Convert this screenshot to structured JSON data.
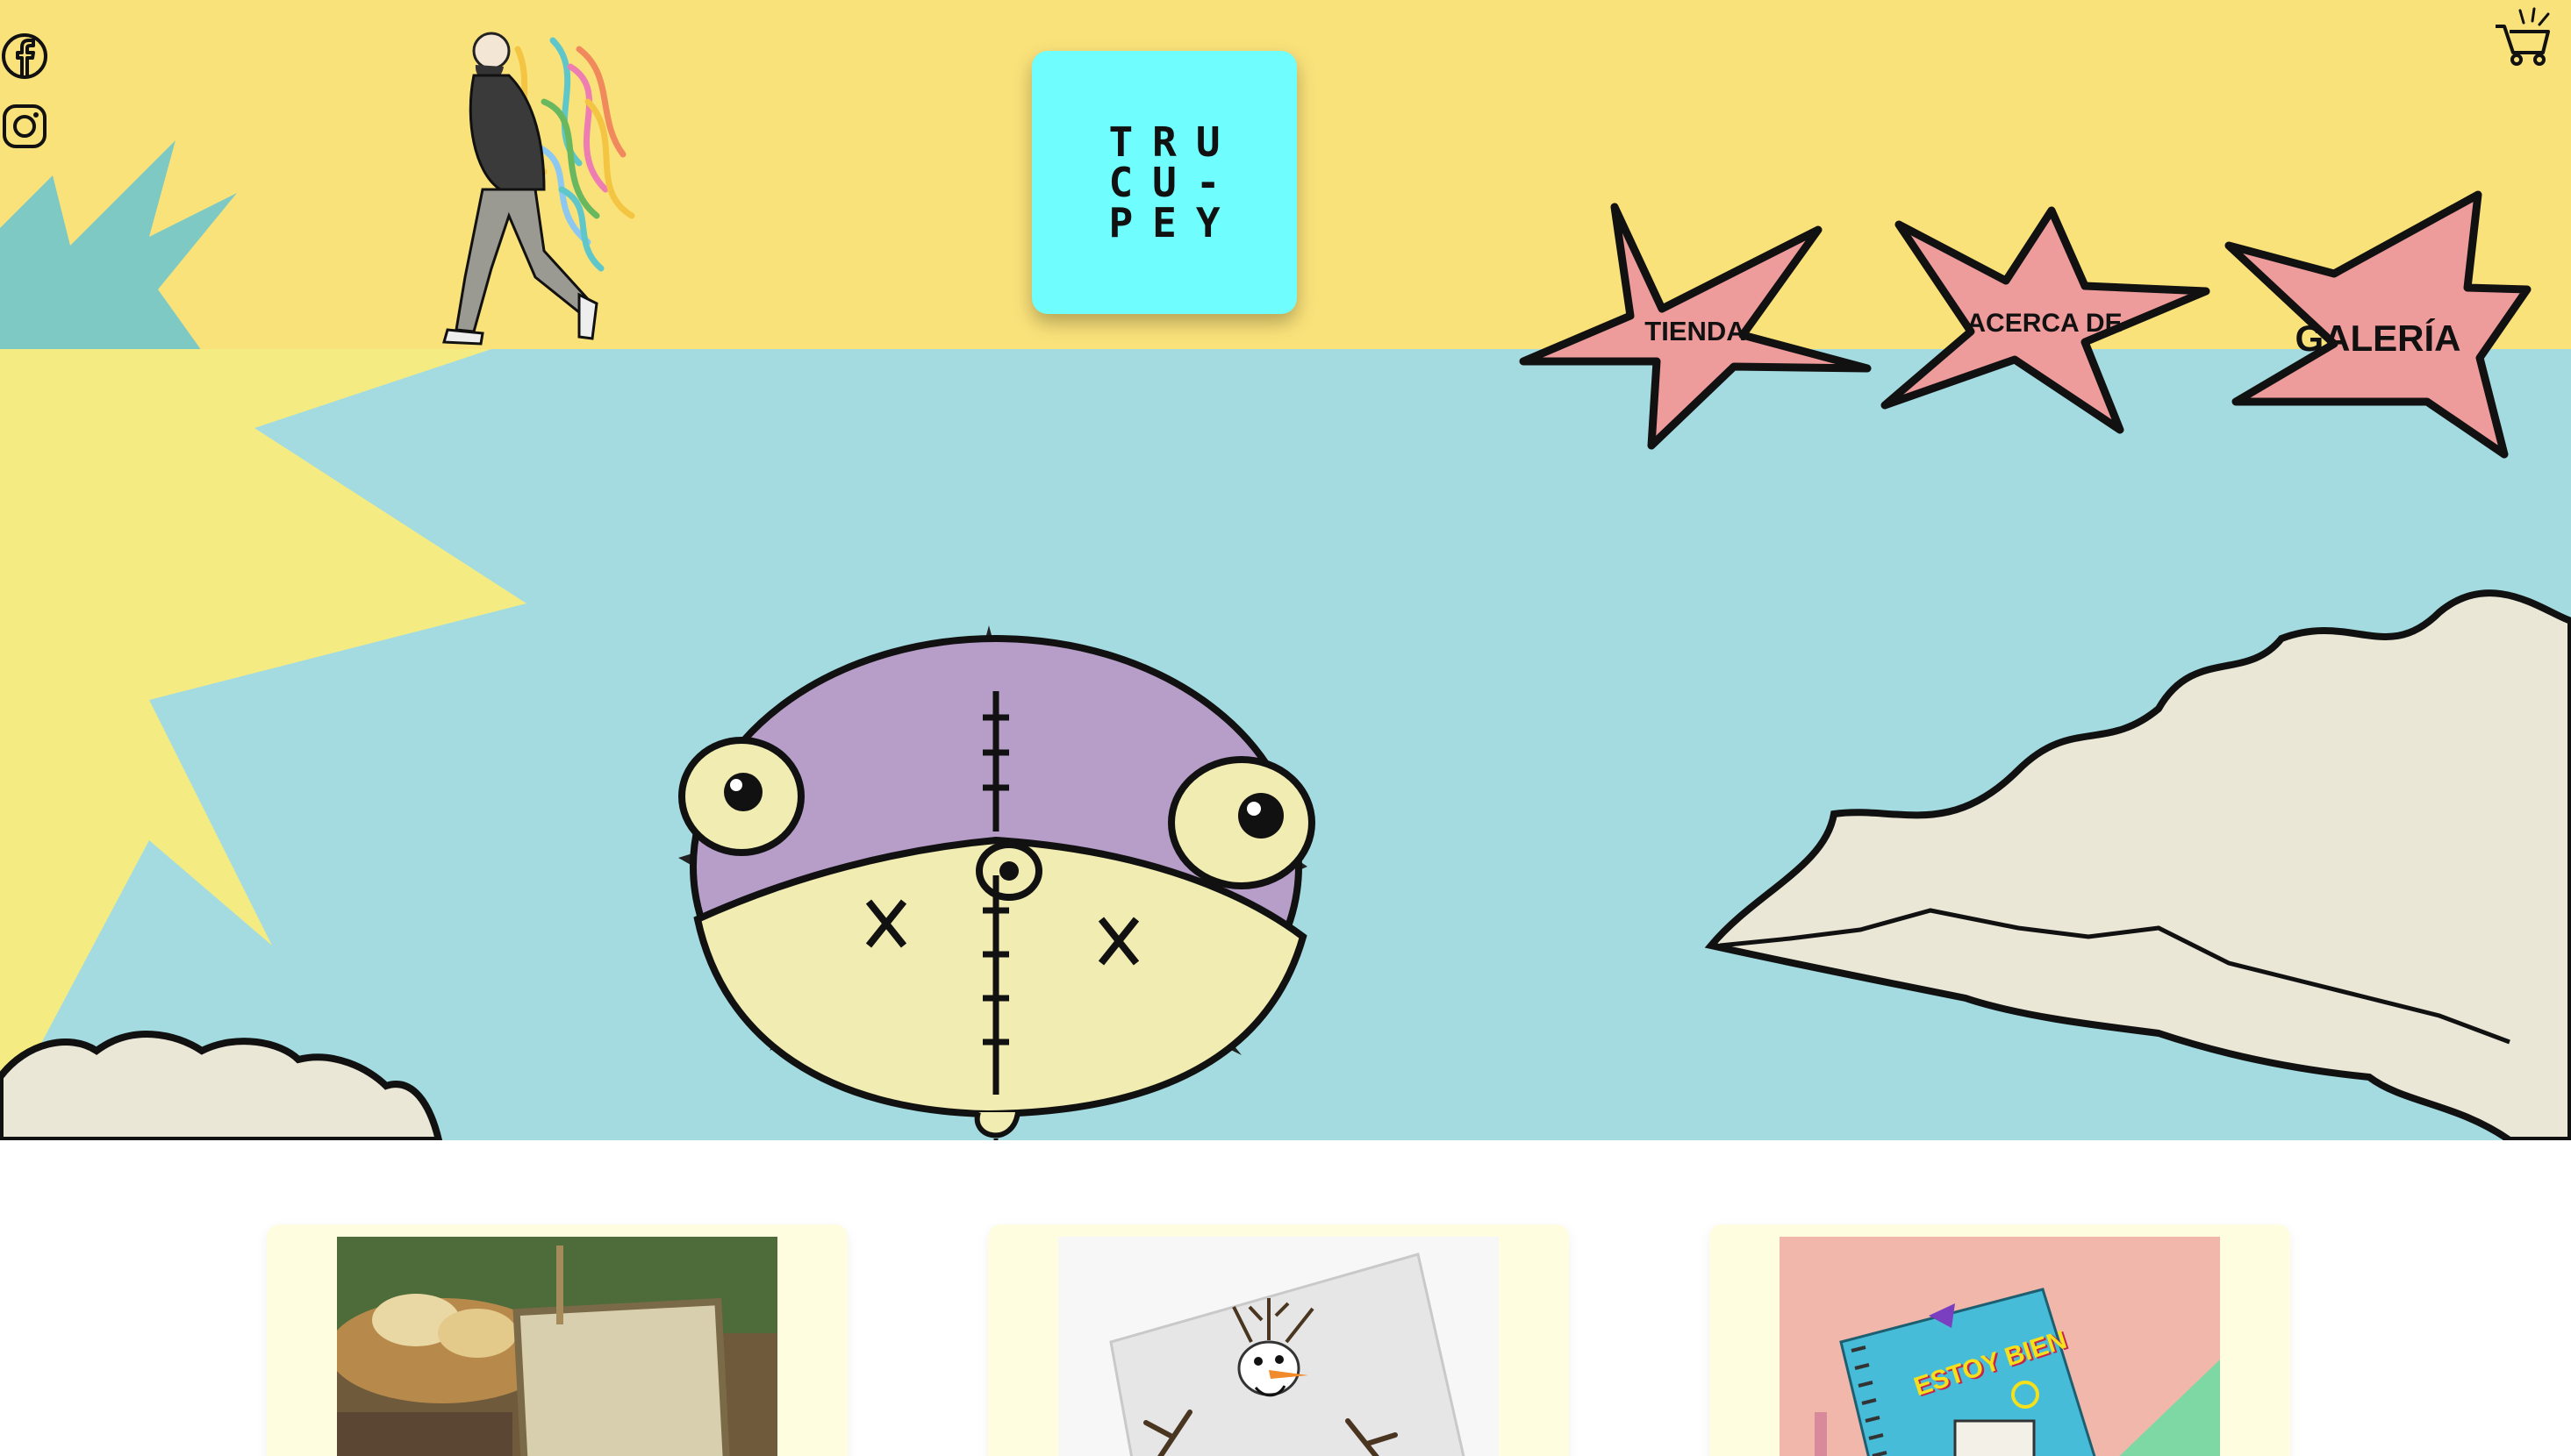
{
  "social": {
    "facebook_icon": "facebook-icon",
    "instagram_icon": "instagram-icon"
  },
  "logo": {
    "line1": "TRU",
    "line2": "CU-",
    "line3": "PEY"
  },
  "cart": {
    "icon": "shopping-cart-icon"
  },
  "nav": {
    "items": [
      {
        "label": "TIENDA"
      },
      {
        "label": "ACERCA DE"
      },
      {
        "label": "GALERÍA"
      }
    ]
  },
  "slider": {
    "active_index": 0,
    "count": 3
  },
  "products": [
    {
      "image": "bread-basket-journal-photo"
    },
    {
      "image": "olaf-notebook-photo"
    },
    {
      "image": "estoy-bien-notebook-photo",
      "cover_text": "ESTOY BIEN"
    }
  ],
  "colors": {
    "header_bg": "#fae27a",
    "hero_bg": "#a3dbe1",
    "logo_bg": "#6ffdfd",
    "nav_star": "#ee9b9b",
    "card_bg": "#fffde0"
  }
}
